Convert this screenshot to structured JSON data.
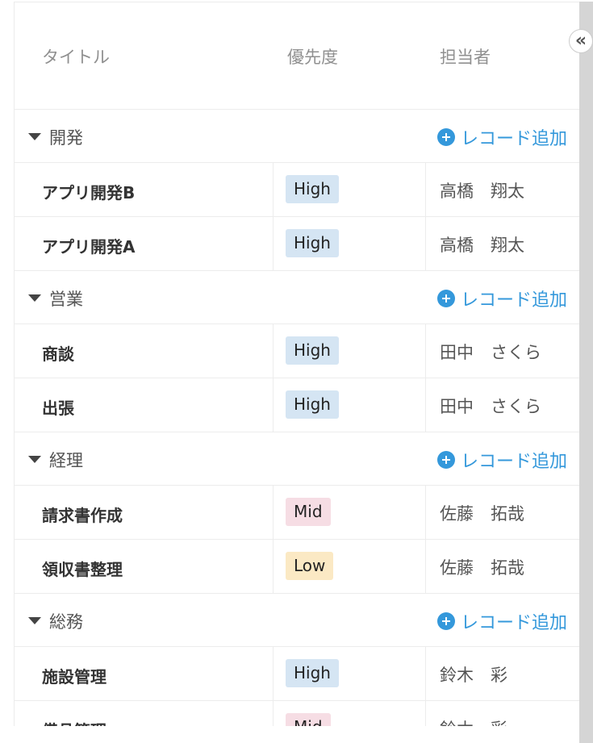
{
  "header": {
    "title": "タイトル",
    "priority": "優先度",
    "assignee": "担当者"
  },
  "add_record_label": "レコード追加",
  "groups": [
    {
      "name": "開発",
      "rows": [
        {
          "title": "アプリ開発B",
          "priority": "High",
          "assignee": "高橋　翔太"
        },
        {
          "title": "アプリ開発A",
          "priority": "High",
          "assignee": "高橋　翔太"
        }
      ]
    },
    {
      "name": "営業",
      "rows": [
        {
          "title": "商談",
          "priority": "High",
          "assignee": "田中　さくら"
        },
        {
          "title": "出張",
          "priority": "High",
          "assignee": "田中　さくら"
        }
      ]
    },
    {
      "name": "経理",
      "rows": [
        {
          "title": "請求書作成",
          "priority": "Mid",
          "assignee": "佐藤　拓哉"
        },
        {
          "title": "領収書整理",
          "priority": "Low",
          "assignee": "佐藤　拓哉"
        }
      ]
    },
    {
      "name": "総務",
      "rows": [
        {
          "title": "施設管理",
          "priority": "High",
          "assignee": "鈴木　彩"
        },
        {
          "title": "備品管理",
          "priority": "Mid",
          "assignee": "鈴木　彩"
        }
      ]
    }
  ],
  "colors": {
    "accent": "#3498db",
    "high_badge": "#d5e5f3",
    "mid_badge": "#f6dde4",
    "low_badge": "#fbe9c4"
  },
  "icons": {
    "caret": "caret-down-icon",
    "add": "plus-circle-icon",
    "collapse": "double-chevron-left-icon"
  }
}
